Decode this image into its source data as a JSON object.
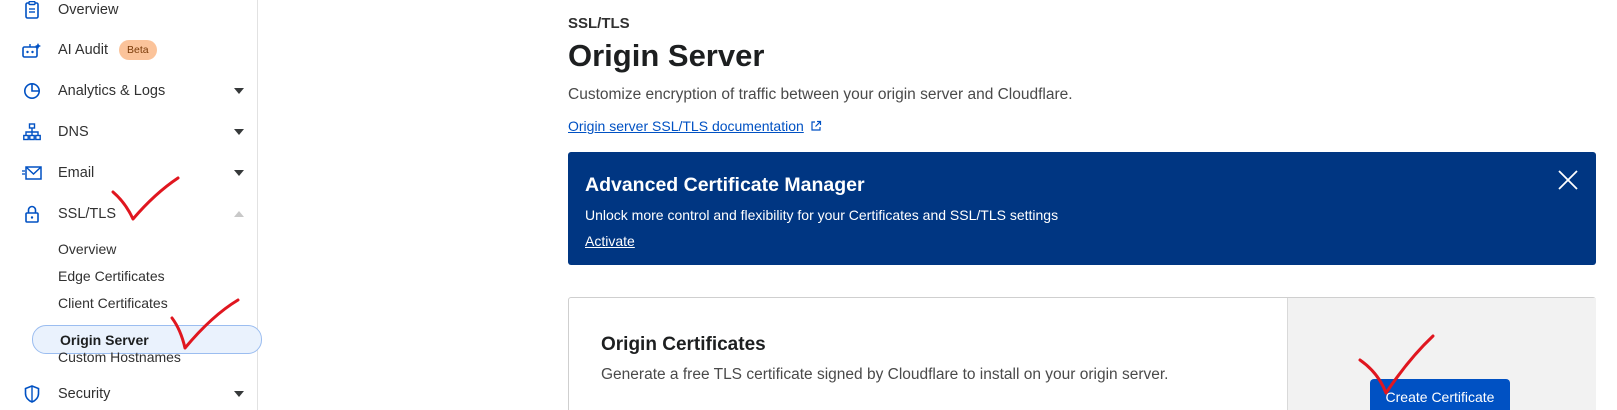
{
  "sidebar": {
    "items": [
      {
        "label": "Overview",
        "icon": "clipboard-icon"
      },
      {
        "label": "AI Audit",
        "icon": "ai-robot-icon",
        "badge": "Beta"
      },
      {
        "label": "Analytics & Logs",
        "icon": "pie-chart-icon"
      },
      {
        "label": "DNS",
        "icon": "network-icon"
      },
      {
        "label": "Email",
        "icon": "envelope-icon"
      },
      {
        "label": "SSL/TLS",
        "icon": "lock-icon"
      },
      {
        "label": "Security",
        "icon": "shield-icon"
      }
    ],
    "ssl_subitems": [
      "Overview",
      "Edge Certificates",
      "Client Certificates",
      "Origin Server",
      "Custom Hostnames"
    ]
  },
  "main": {
    "breadcrumb": "SSL/TLS",
    "title": "Origin Server",
    "description": "Customize encryption of traffic between your origin server and Cloudflare.",
    "doc_link": "Origin server SSL/TLS documentation",
    "acm": {
      "title": "Advanced Certificate Manager",
      "text": "Unlock more control and flexibility for your Certificates and SSL/TLS settings",
      "link": "Activate"
    },
    "origin_card": {
      "title": "Origin Certificates",
      "text": "Generate a free TLS certificate signed by Cloudflare to install on your origin server.",
      "button": "Create Certificate"
    }
  },
  "colors": {
    "accent": "#0051c3",
    "banner": "#003682",
    "annotation": "#e0161f"
  }
}
